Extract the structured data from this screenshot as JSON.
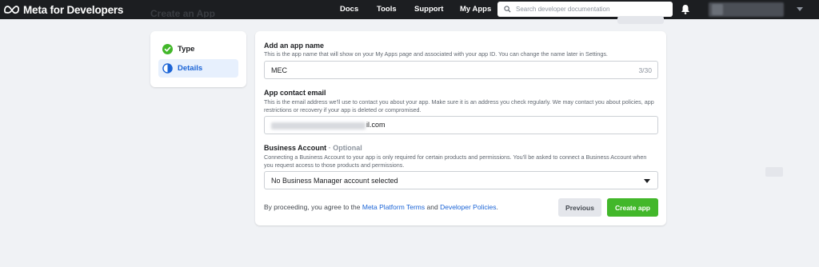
{
  "header": {
    "brand": "Meta for Developers",
    "ghost_title": "Create an App",
    "nav": [
      "Docs",
      "Tools",
      "Support",
      "My Apps"
    ],
    "search_placeholder": "Search developer documentation"
  },
  "steps": [
    {
      "label": "Type",
      "state": "complete",
      "icon": "check-circle-icon"
    },
    {
      "label": "Details",
      "state": "active",
      "icon": "half-circle-icon"
    }
  ],
  "form": {
    "app_name": {
      "label": "Add an app name",
      "help": "This is the app name that will show on your My Apps page and associated with your app ID. You can change the name later in Settings.",
      "value": "MEC",
      "counter": "3/30"
    },
    "contact_email": {
      "label": "App contact email",
      "help": "This is the email address we'll use to contact you about your app. Make sure it is an address you check regularly. We may contact you about policies, app restrictions or recovery if your app is deleted or compromised.",
      "value_visible": "il.com"
    },
    "business_account": {
      "label": "Business Account",
      "optional": "· Optional",
      "help": "Connecting a Business Account to your app is only required for certain products and permissions. You'll be asked to connect a Business Account when you request access to those products and permissions.",
      "selected": "No Business Manager account selected"
    },
    "terms": {
      "prefix": "By proceeding, you agree to the",
      "link1": "Meta Platform Terms",
      "middle": "and",
      "link2": "Developer Policies",
      "suffix": "."
    },
    "buttons": {
      "previous": "Previous",
      "create": "Create app"
    }
  },
  "colors": {
    "topbar": "#1c1e21",
    "accent_blue": "#1b64d6",
    "create_green": "#42b72a",
    "page_bg": "#f0f2f5"
  }
}
